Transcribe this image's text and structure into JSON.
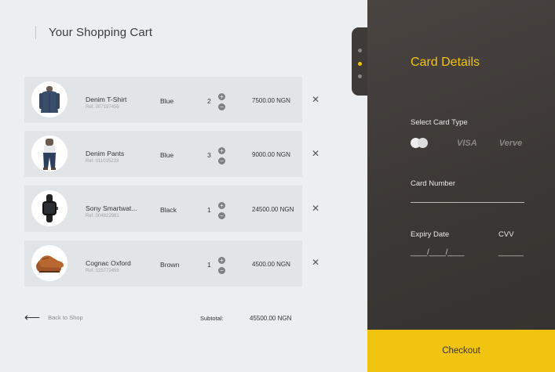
{
  "cart": {
    "title": "Your Shopping Cart",
    "items": [
      {
        "name": "Denim T-Shirt",
        "ref": "Ref. 007197456",
        "color": "Blue",
        "qty": "2",
        "price": "7500.00 NGN",
        "image": "denim-shirt-image"
      },
      {
        "name": "Denim Pants",
        "ref": "Ref. 011015233",
        "color": "Blue",
        "qty": "3",
        "price": "9000.00 NGN",
        "image": "denim-pants-image"
      },
      {
        "name": "Sony Smartwat...",
        "ref": "Ref. 004822981",
        "color": "Black",
        "qty": "1",
        "price": "24500.00 NGN",
        "image": "smartwatch-image"
      },
      {
        "name": "Cognac Oxford",
        "ref": "Ref. 025772459",
        "color": "Brown",
        "qty": "1",
        "price": "4500.00 NGN",
        "image": "oxford-shoes-image"
      }
    ],
    "increment_symbol": "+",
    "decrement_symbol": "−",
    "remove_symbol": "✕",
    "back_arrow": "⟵",
    "back_label": "Back to Shop",
    "subtotal_label": "Subtotal:",
    "subtotal_value": "45500.00 NGN"
  },
  "payment": {
    "title": "Card Details",
    "card_type_label": "Select Card Type",
    "card_types": [
      "mastercard-icon",
      "VISA",
      "Verve"
    ],
    "card_number_label": "Card Number",
    "expiry_label": "Expiry Date",
    "expiry_blanks": "____/____/____",
    "cvv_label": "CVV",
    "cvv_blanks": "______",
    "checkout_label": "Checkout"
  },
  "colors": {
    "accent": "#f1c40f",
    "panel_dark": "#3b3734",
    "cart_bg": "#eceff1",
    "item_bg": "#e2e5e7"
  }
}
